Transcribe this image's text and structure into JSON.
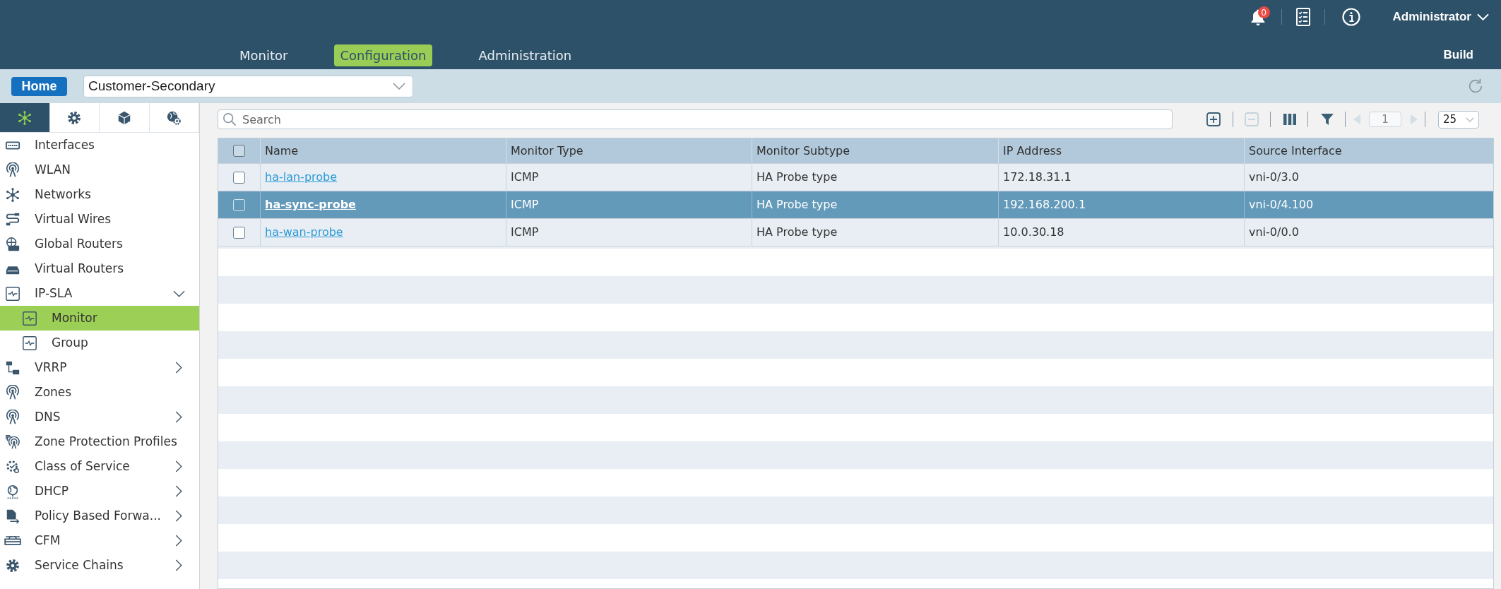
{
  "header": {
    "notification_badge": "0",
    "user_menu": "Administrator",
    "nav_tabs": [
      {
        "label": "Monitor",
        "selected": false
      },
      {
        "label": "Configuration",
        "selected": true
      },
      {
        "label": "Administration",
        "selected": false
      }
    ],
    "build_label": "Build"
  },
  "context_bar": {
    "home_button": "Home",
    "organization": "Customer-Secondary"
  },
  "sidebar": {
    "tabs": [
      {
        "selected": true
      },
      {
        "selected": false
      },
      {
        "selected": false
      },
      {
        "selected": false
      }
    ],
    "items": [
      {
        "label": "Interfaces",
        "selected": false
      },
      {
        "label": "WLAN",
        "selected": false
      },
      {
        "label": "Networks",
        "selected": false
      },
      {
        "label": "Virtual Wires",
        "selected": false
      },
      {
        "label": "Global Routers",
        "selected": false
      },
      {
        "label": "Virtual Routers",
        "selected": false
      },
      {
        "label": "IP-SLA",
        "selected": false,
        "expanded": true,
        "children": [
          {
            "label": "Monitor",
            "selected": true
          },
          {
            "label": "Group",
            "selected": false
          }
        ]
      },
      {
        "label": "VRRP",
        "selected": false,
        "expanded": false
      },
      {
        "label": "Zones",
        "selected": false
      },
      {
        "label": "DNS",
        "selected": false,
        "expanded": false
      },
      {
        "label": "Zone Protection Profiles",
        "selected": false
      },
      {
        "label": "Class of Service",
        "selected": false,
        "expanded": false
      },
      {
        "label": "DHCP",
        "selected": false,
        "expanded": false
      },
      {
        "label": "Policy Based Forwa...",
        "selected": false,
        "expanded": false
      },
      {
        "label": "CFM",
        "selected": false,
        "expanded": false
      },
      {
        "label": "Service Chains",
        "selected": false,
        "expanded": false
      }
    ]
  },
  "toolbar": {
    "search": {
      "placeholder": "Search"
    },
    "buttons": [
      {
        "disabled": false
      },
      {
        "disabled": true
      },
      {
        "disabled": false
      },
      {
        "disabled": false
      }
    ],
    "pager": {
      "previous_disabled": true,
      "page": "1",
      "next_disabled": true
    },
    "page_size": "25"
  },
  "table": {
    "header_checked": false,
    "columns": [
      "Name",
      "Monitor Type",
      "Monitor Subtype",
      "IP Address",
      "Source Interface"
    ],
    "rows": [
      {
        "selected": false,
        "checked": false,
        "cells": [
          "ha-lan-probe",
          "ICMP",
          "HA Probe type",
          "172.18.31.1",
          "vni-0/3.0"
        ]
      },
      {
        "selected": true,
        "checked": false,
        "cells": [
          "ha-sync-probe",
          "ICMP",
          "HA Probe type",
          "192.168.200.1",
          "vni-0/4.100"
        ]
      },
      {
        "selected": false,
        "checked": false,
        "cells": [
          "ha-wan-probe",
          "ICMP",
          "HA Probe type",
          "10.0.30.18",
          "vni-0/0.0"
        ]
      }
    ]
  }
}
